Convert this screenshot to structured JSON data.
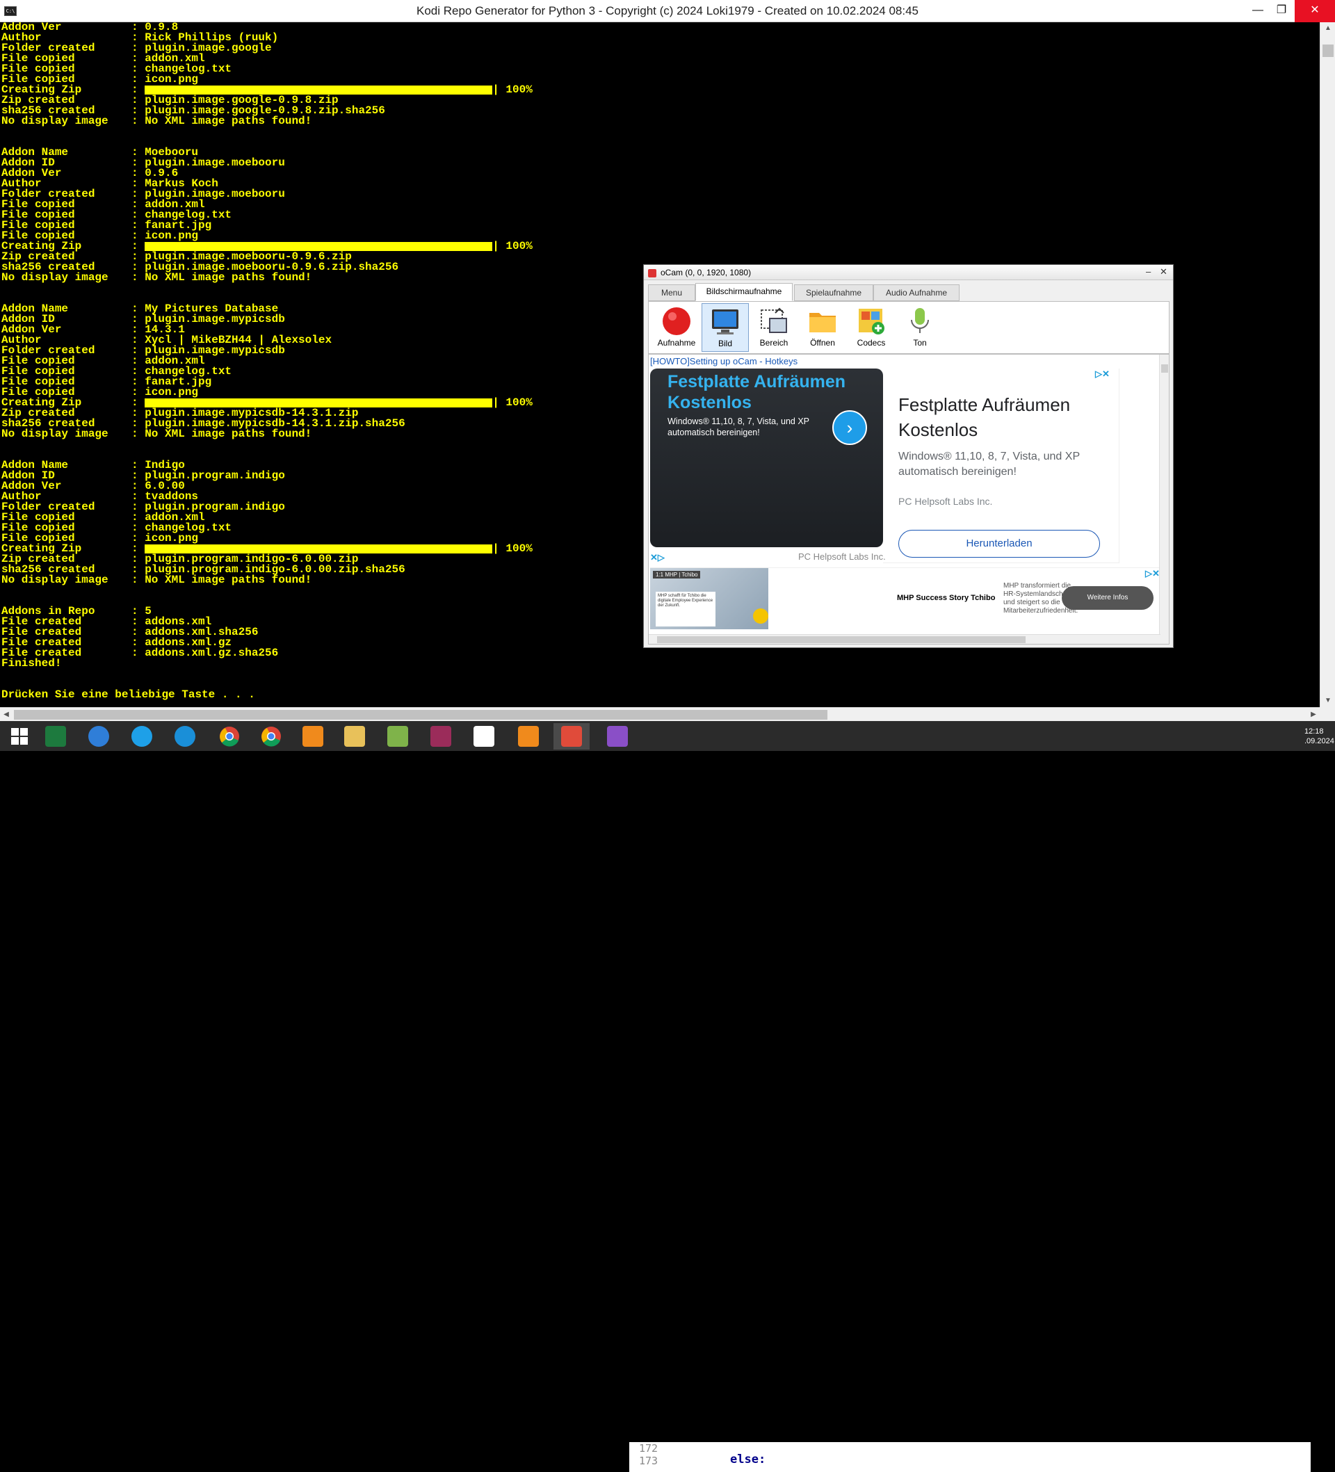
{
  "window": {
    "title": "Kodi Repo Generator for Python 3 - Copyright (c) 2024 Loki1979 - Created on 10.02.2024 08:45",
    "icon": "cmd-icon",
    "minimize": "—",
    "maximize": "❐",
    "close": "✕"
  },
  "console": {
    "lines": [
      {
        "k": "Addon Ver",
        "v": "0.9.8"
      },
      {
        "k": "Author",
        "v": "Rick Phillips (ruuk)"
      },
      {
        "k": "Folder created",
        "v": "plugin.image.google"
      },
      {
        "k": "File copied",
        "v": "addon.xml"
      },
      {
        "k": "File copied",
        "v": "changelog.txt"
      },
      {
        "k": "File copied",
        "v": "icon.png"
      },
      {
        "k": "Creating Zip",
        "v": "100%",
        "bar": true
      },
      {
        "k": "Zip created",
        "v": "plugin.image.google-0.9.8.zip"
      },
      {
        "k": "sha256 created",
        "v": "plugin.image.google-0.9.8.zip.sha256"
      },
      {
        "k": "No display image",
        "v": "No XML image paths found!"
      },
      {
        "k": "",
        "v": ""
      },
      {
        "k": "",
        "v": ""
      },
      {
        "k": "Addon Name",
        "v": "Moebooru"
      },
      {
        "k": "Addon ID",
        "v": "plugin.image.moebooru"
      },
      {
        "k": "Addon Ver",
        "v": "0.9.6"
      },
      {
        "k": "Author",
        "v": "Markus Koch"
      },
      {
        "k": "Folder created",
        "v": "plugin.image.moebooru"
      },
      {
        "k": "File copied",
        "v": "addon.xml"
      },
      {
        "k": "File copied",
        "v": "changelog.txt"
      },
      {
        "k": "File copied",
        "v": "fanart.jpg"
      },
      {
        "k": "File copied",
        "v": "icon.png"
      },
      {
        "k": "Creating Zip",
        "v": "100%",
        "bar": true
      },
      {
        "k": "Zip created",
        "v": "plugin.image.moebooru-0.9.6.zip"
      },
      {
        "k": "sha256 created",
        "v": "plugin.image.moebooru-0.9.6.zip.sha256"
      },
      {
        "k": "No display image",
        "v": "No XML image paths found!"
      },
      {
        "k": "",
        "v": ""
      },
      {
        "k": "",
        "v": ""
      },
      {
        "k": "Addon Name",
        "v": "My Pictures Database"
      },
      {
        "k": "Addon ID",
        "v": "plugin.image.mypicsdb"
      },
      {
        "k": "Addon Ver",
        "v": "14.3.1"
      },
      {
        "k": "Author",
        "v": "Xycl | MikeBZH44 | Alexsolex"
      },
      {
        "k": "Folder created",
        "v": "plugin.image.mypicsdb"
      },
      {
        "k": "File copied",
        "v": "addon.xml"
      },
      {
        "k": "File copied",
        "v": "changelog.txt"
      },
      {
        "k": "File copied",
        "v": "fanart.jpg"
      },
      {
        "k": "File copied",
        "v": "icon.png"
      },
      {
        "k": "Creating Zip",
        "v": "100%",
        "bar": true
      },
      {
        "k": "Zip created",
        "v": "plugin.image.mypicsdb-14.3.1.zip"
      },
      {
        "k": "sha256 created",
        "v": "plugin.image.mypicsdb-14.3.1.zip.sha256"
      },
      {
        "k": "No display image",
        "v": "No XML image paths found!"
      },
      {
        "k": "",
        "v": ""
      },
      {
        "k": "",
        "v": ""
      },
      {
        "k": "Addon Name",
        "v": "Indigo"
      },
      {
        "k": "Addon ID",
        "v": "plugin.program.indigo"
      },
      {
        "k": "Addon Ver",
        "v": "6.0.00"
      },
      {
        "k": "Author",
        "v": "tvaddons"
      },
      {
        "k": "Folder created",
        "v": "plugin.program.indigo"
      },
      {
        "k": "File copied",
        "v": "addon.xml"
      },
      {
        "k": "File copied",
        "v": "changelog.txt"
      },
      {
        "k": "File copied",
        "v": "icon.png"
      },
      {
        "k": "Creating Zip",
        "v": "100%",
        "bar": true
      },
      {
        "k": "Zip created",
        "v": "plugin.program.indigo-6.0.00.zip"
      },
      {
        "k": "sha256 created",
        "v": "plugin.program.indigo-6.0.00.zip.sha256"
      },
      {
        "k": "No display image",
        "v": "No XML image paths found!"
      },
      {
        "k": "",
        "v": ""
      },
      {
        "k": "",
        "v": ""
      },
      {
        "k": "Addons in Repo",
        "v": "5"
      },
      {
        "k": "File created",
        "v": "addons.xml"
      },
      {
        "k": "File created",
        "v": "addons.xml.sha256"
      },
      {
        "k": "File created",
        "v": "addons.xml.gz"
      },
      {
        "k": "File created",
        "v": "addons.xml.gz.sha256"
      },
      {
        "k": "Finished!",
        "v": "",
        "plain": true
      },
      {
        "k": "",
        "v": ""
      },
      {
        "k": "",
        "v": ""
      },
      {
        "k": "Drücken Sie eine beliebige Taste . . .",
        "v": "",
        "plain": true
      }
    ]
  },
  "ocam": {
    "title": "oCam (0, 0, 1920, 1080)",
    "tabs": [
      "Menu",
      "Bildschirmaufnahme",
      "Spielaufnahme",
      "Audio Aufnahme"
    ],
    "tools": [
      {
        "label": "Aufnahme",
        "icon": "record-icon"
      },
      {
        "label": "Bild",
        "icon": "monitor-icon"
      },
      {
        "label": "Bereich",
        "icon": "region-icon"
      },
      {
        "label": "Öffnen",
        "icon": "folder-icon"
      },
      {
        "label": "Codecs",
        "icon": "codecs-icon"
      },
      {
        "label": "Ton",
        "icon": "microphone-icon"
      }
    ],
    "howto": "[HOWTO]Setting up oCam - Hotkeys",
    "ad1": {
      "headline": "Festplatte Aufräumen Kostenlos",
      "text": "Windows® 11,10, 8, 7, Vista, und XP automatisch bereinigen!"
    },
    "ad2": {
      "headline": "Festplatte Aufräumen Kostenlos",
      "text": "Windows® 11,10, 8, 7, Vista, und XP automatisch bereinigen!",
      "company": "PC Helpsoft Labs Inc.",
      "button": "Herunterladen"
    },
    "ad_footer": "PC Helpsoft Labs Inc.",
    "ad3": {
      "logo": "1:1 MHP | Tchibo",
      "box_text": "MHP schafft für Tchibo die digitale Employee Experience der Zukunft.",
      "title": "MHP Success Story Tchibo",
      "text": "MHP transformiert die HR-Systemlandschaft und steigert so die Mitarbeiterzufriedenheit.",
      "button": "Weitere Infos"
    }
  },
  "taskbar": {
    "apps": [
      {
        "name": "start-button",
        "icon": "windows-icon",
        "color": "#ffffff"
      },
      {
        "name": "excel",
        "icon": "excel-icon",
        "color": "#1d7a3e"
      },
      {
        "name": "thunderbird",
        "icon": "thunderbird-icon",
        "color": "#2f7ed8"
      },
      {
        "name": "internet-explorer",
        "icon": "ie-icon",
        "color": "#1ea0e8"
      },
      {
        "name": "edge",
        "icon": "edge-icon",
        "color": "#1a8fd8"
      },
      {
        "name": "chrome-b",
        "icon": "chrome-icon",
        "color": "#d84a38"
      },
      {
        "name": "chrome",
        "icon": "chrome-icon",
        "color": "#e0b300"
      },
      {
        "name": "brave-vpn",
        "icon": "shield-icon",
        "color": "#f08a1c"
      },
      {
        "name": "file-explorer",
        "icon": "folder-icon",
        "color": "#e8c15a"
      },
      {
        "name": "notepad-plus",
        "icon": "notepad-icon",
        "color": "#7fb34a"
      },
      {
        "name": "winrar",
        "icon": "winrar-icon",
        "color": "#9b2c5a"
      },
      {
        "name": "7zip",
        "icon": "7zip-icon",
        "color": "#ffffff"
      },
      {
        "name": "vlc",
        "icon": "vlc-icon",
        "color": "#f08a1c"
      },
      {
        "name": "ocam",
        "icon": "ocam-icon",
        "color": "#e04b3a"
      },
      {
        "name": "visual-studio",
        "icon": "vs-icon",
        "color": "#8a4fc7"
      }
    ],
    "code_lines": [
      "172",
      "173"
    ],
    "code_keyword": "else:",
    "clock_time": "12:18",
    "clock_date": ".09.2024"
  }
}
